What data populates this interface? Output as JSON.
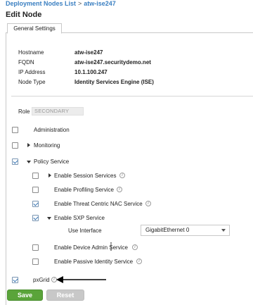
{
  "breadcrumb": {
    "root": "Deployment Nodes List",
    "separator": ">",
    "current": "atw-ise247"
  },
  "page_title": "Edit Node",
  "tabs": [
    {
      "label": "General Settings",
      "active": true
    }
  ],
  "node_info": {
    "hostname_label": "Hostname",
    "hostname": "atw-ise247",
    "fqdn_label": "FQDN",
    "fqdn": "atw-ise247.securitydemo.net",
    "ip_label": "IP Address",
    "ip": "10.1.100.247",
    "type_label": "Node Type",
    "type": "Identity Services Engine (ISE)"
  },
  "role": {
    "label": "Role",
    "value": "SECONDARY"
  },
  "services": {
    "administration": {
      "label": "Administration",
      "checked": false
    },
    "monitoring": {
      "label": "Monitoring",
      "checked": false
    },
    "policy_service": {
      "label": "Policy Service",
      "checked": true
    },
    "session_services": {
      "label": "Enable Session Services",
      "checked": false
    },
    "profiling": {
      "label": "Enable Profiling Service",
      "checked": false
    },
    "threat_centric_nac": {
      "label": "Enable Threat Centric NAC Service",
      "checked": true
    },
    "sxp": {
      "label": "Enable SXP Service",
      "checked": true
    },
    "use_interface": {
      "label": "Use Interface",
      "value": "GigabitEthernet 0"
    },
    "device_admin": {
      "label": "Enable Device Admin Service",
      "checked": false
    },
    "passive_identity": {
      "label": "Enable Passive Identity Service",
      "checked": false
    },
    "pxgrid": {
      "label": "pxGrid",
      "checked": true
    }
  },
  "actions": {
    "save_label": "Save",
    "reset_label": "Reset"
  },
  "colors": {
    "link": "#3a7fc1",
    "save": "#5aa43a",
    "reset_disabled": "#c8c8c8"
  },
  "icons": [
    "info-icon",
    "expand-arrow-icon",
    "collapse-arrow-icon",
    "dropdown-caret-icon",
    "annotation-arrow-icon",
    "mouse-cursor-icon"
  ]
}
